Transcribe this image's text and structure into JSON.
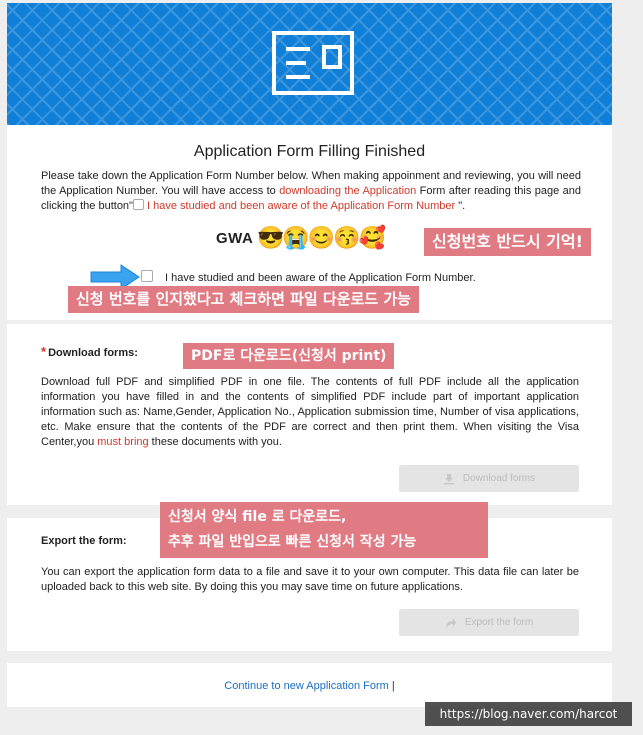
{
  "top": {
    "title": "Application Form Filling Finished",
    "instructions_1": "Please take down the Application Form Number below. When making appoinment and reviewing, you will need the Application Number. You will have access to ",
    "instructions_link": "downloading the Application",
    "instructions_2": " Form after reading this page and clicking the button\"",
    "instructions_red": " I have studied and been aware of the Application Form Number ",
    "instructions_3": "\".",
    "app_number_prefix": "GWA",
    "app_number_obscured": "😎😭😊😚🥰",
    "agree_label": "I have studied and been aware of the Application Form Number."
  },
  "annotations": {
    "remember_number": "신청번호 반드시 기억!",
    "check_to_download": "신청 번호를 인지했다고 체크하면 파일 다운로드 가능",
    "pdf_download": "PDF로 다운로드(신청서 print)",
    "export_line1": "신청서 양식 file 로 다운로드,",
    "export_line2": "추후 파일 반입으로 빠른 신청서 작성 가능"
  },
  "download": {
    "star": "*",
    "label": "Download forms:",
    "text_1": "Download full PDF and simplified PDF in one file. The contents of full PDF include all the application information you have filled in and the contents of simplified PDF include part of important application information such as: Name,Gender, Application No., Application submission time, Number of visa applications, etc. Make ensure that the contents of the PDF are correct and then print them. When visiting the Visa Center,you ",
    "text_red": "must bring",
    "text_2": " these documents with you.",
    "button": "Download forms"
  },
  "export": {
    "label": "Export the form:",
    "text": "You can export the application form data to a file and save it to your own computer. This data file can later be uploaded back to this web site. By doing this you may save time on future applications.",
    "button": "Export the form"
  },
  "footer": {
    "continue": "Continue to new Application Form",
    "separator": " |"
  },
  "watermark": "https://blog.naver.com/harcot",
  "colors": {
    "banner": "#0f7fd7",
    "accent_red": "#d03a2b",
    "link_blue": "#1a6fc2",
    "annotation_pink": "#e07a83"
  }
}
